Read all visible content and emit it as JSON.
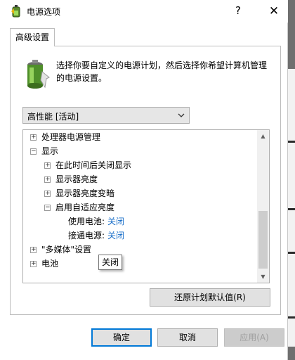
{
  "window": {
    "title": "电源选项",
    "help_glyph": "?",
    "close_glyph": "✕"
  },
  "tab": {
    "label": "高级设置"
  },
  "description": "选择你要自定义的电源计划，然后选择你希望计算机管理的电源设置。",
  "plan_select": {
    "value": "高性能 [活动]"
  },
  "tree": [
    {
      "label": "处理器电源管理",
      "expander": "+"
    },
    {
      "label": "显示",
      "expander": "−"
    },
    {
      "label": "在此时间后关闭显示",
      "expander": "+"
    },
    {
      "label": "显示器亮度",
      "expander": "+"
    },
    {
      "label": "显示器亮度变暗",
      "expander": "+"
    },
    {
      "label": "启用自适应亮度",
      "expander": "−"
    },
    {
      "label": "使用电池:",
      "value": "关闭"
    },
    {
      "label": "接通电源:",
      "value": "关闭"
    },
    {
      "label": "\"多媒体\"设置",
      "expander": "+"
    },
    {
      "label": "电池",
      "expander": "+"
    }
  ],
  "tooltip": "关闭",
  "buttons": {
    "restore_defaults": "还原计划默认值(R)",
    "ok": "确定",
    "cancel": "取消",
    "apply": "应用(A)"
  },
  "colors": {
    "accent": "#0078d7",
    "link": "#1a6fc9"
  }
}
